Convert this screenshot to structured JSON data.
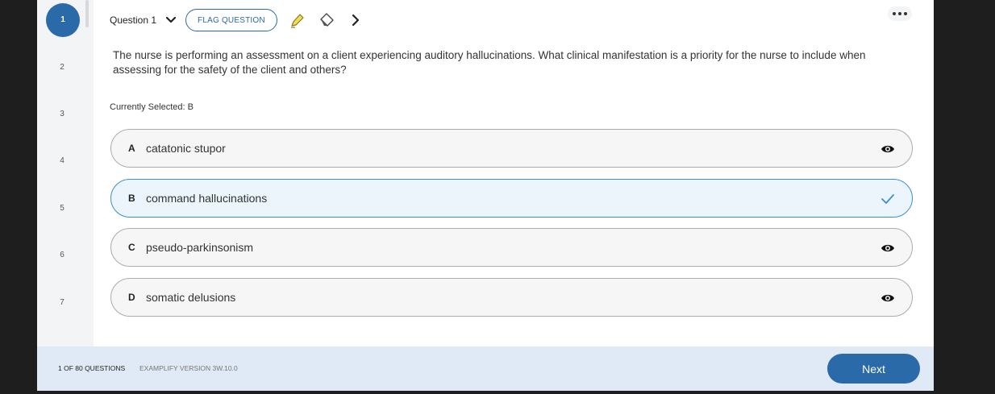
{
  "rail": {
    "items": [
      "1",
      "2",
      "3",
      "4",
      "5",
      "6",
      "7"
    ],
    "active_index": 0
  },
  "toolbar": {
    "question_label": "Question 1",
    "flag_label": "FLAG QUESTION"
  },
  "question": {
    "stem": "The nurse is performing an assessment on a client experiencing auditory hallucinations. What clinical manifestation is a priority for the nurse to include when assessing for the safety of the client and others?",
    "currently_selected": "Currently Selected: B",
    "answers": [
      {
        "letter": "A",
        "text": "catatonic stupor",
        "icon": "eye-icon"
      },
      {
        "letter": "B",
        "text": "command hallucinations",
        "icon": "check-icon"
      },
      {
        "letter": "C",
        "text": "pseudo-parkinsonism",
        "icon": "eye-icon"
      },
      {
        "letter": "D",
        "text": "somatic delusions",
        "icon": "eye-icon"
      }
    ]
  },
  "footer": {
    "count": "1 OF 80 QUESTIONS",
    "version": "EXAMPLIFY VERSION 3W.10.0",
    "next_label": "Next"
  },
  "colors": {
    "accent": "#2b6aa8",
    "selected_border": "#3a8fd0",
    "footer_bg": "#dfeaf6"
  }
}
